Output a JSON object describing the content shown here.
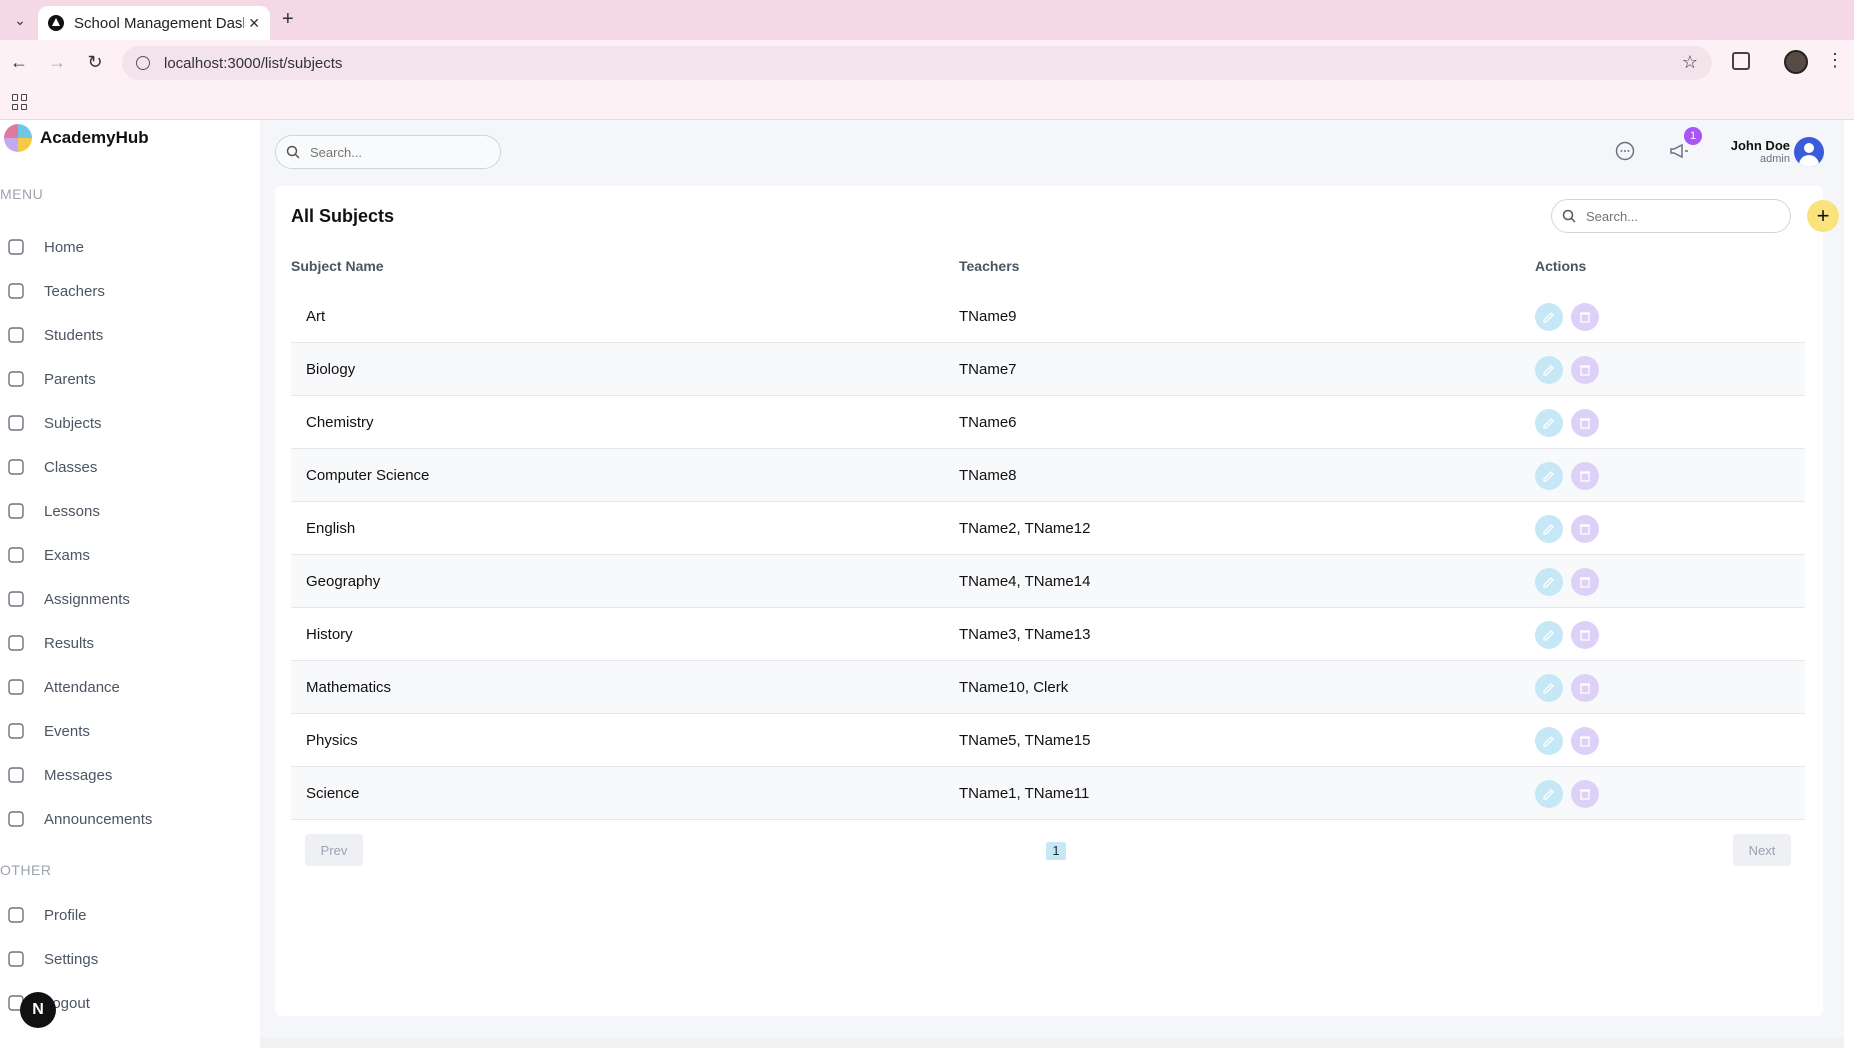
{
  "browser": {
    "tab_title": "School Management Dashboard",
    "url": "localhost:3000/list/subjects"
  },
  "app": {
    "logo_text": "AcademyHub"
  },
  "sidebar": {
    "menu_label": "MENU",
    "other_label": "OTHER",
    "menu_items": [
      {
        "label": "Home",
        "icon": "home-icon"
      },
      {
        "label": "Teachers",
        "icon": "teacher-icon"
      },
      {
        "label": "Students",
        "icon": "students-icon"
      },
      {
        "label": "Parents",
        "icon": "parents-icon"
      },
      {
        "label": "Subjects",
        "icon": "subjects-icon"
      },
      {
        "label": "Classes",
        "icon": "classes-icon"
      },
      {
        "label": "Lessons",
        "icon": "lessons-icon"
      },
      {
        "label": "Exams",
        "icon": "exams-icon"
      },
      {
        "label": "Assignments",
        "icon": "assignments-icon"
      },
      {
        "label": "Results",
        "icon": "results-icon"
      },
      {
        "label": "Attendance",
        "icon": "attendance-icon"
      },
      {
        "label": "Events",
        "icon": "calendar-icon"
      },
      {
        "label": "Messages",
        "icon": "message-icon"
      },
      {
        "label": "Announcements",
        "icon": "megaphone-icon"
      }
    ],
    "other_items": [
      {
        "label": "Profile",
        "icon": "profile-icon"
      },
      {
        "label": "Settings",
        "icon": "gear-icon"
      },
      {
        "label": "Logout",
        "icon": "logout-icon"
      }
    ]
  },
  "topbar": {
    "search_placeholder": "Search...",
    "notification_count": "1",
    "user_name": "John Doe",
    "user_role": "admin"
  },
  "list": {
    "title": "All Subjects",
    "search_placeholder": "Search...",
    "add_label": "+",
    "columns": [
      "Subject Name",
      "Teachers",
      "Actions"
    ],
    "rows": [
      {
        "subject": "Art",
        "teachers": "TName9"
      },
      {
        "subject": "Biology",
        "teachers": "TName7"
      },
      {
        "subject": "Chemistry",
        "teachers": "TName6"
      },
      {
        "subject": "Computer Science",
        "teachers": "TName8"
      },
      {
        "subject": "English",
        "teachers": "TName2, TName12"
      },
      {
        "subject": "Geography",
        "teachers": "TName4, TName14"
      },
      {
        "subject": "History",
        "teachers": "TName3, TName13"
      },
      {
        "subject": "Mathematics",
        "teachers": "TName10, Clerk"
      },
      {
        "subject": "Physics",
        "teachers": "TName5, TName15"
      },
      {
        "subject": "Science",
        "teachers": "TName1, TName11"
      }
    ]
  },
  "pagination": {
    "prev_label": "Prev",
    "next_label": "Next",
    "current_page": "1"
  },
  "colors": {
    "edit_action": "#c6e8f6",
    "delete_action": "#ddd1f7",
    "add_button": "#fae27c",
    "badge": "#a855f7",
    "tab_strip": "#f5d8e6"
  },
  "overlay": {
    "fab_label": "N"
  }
}
